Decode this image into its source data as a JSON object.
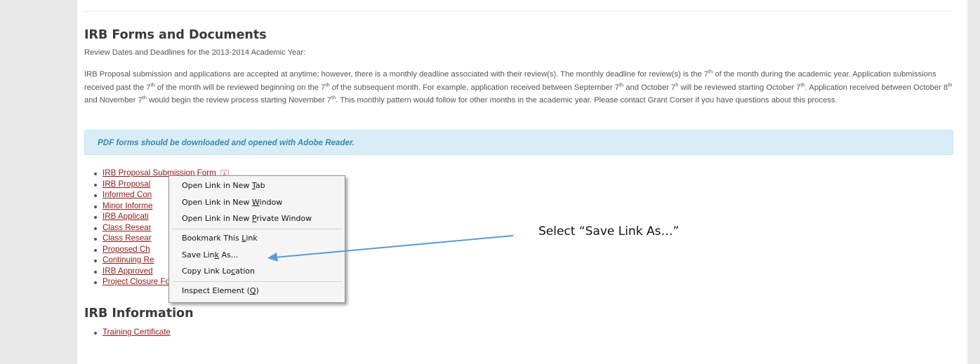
{
  "content": {
    "heading": "IRB Forms and Documents",
    "subtitle": "Review Dates and Deadlines for the 2013-2014 Academic Year:",
    "paragraph": {
      "p1": "IRB Proposal submission and applications are accepted at anytime; however, there is a monthly deadline associated with their review(s). The monthly deadline for review(s) is the 7",
      "p2": " of the month during the academic year. Application submissions received past the 7",
      "p3": " of the month will be reviewed beginning on the 7",
      "p4": " of the subsequent month. For example, application received between September 7",
      "p5": " and October 7",
      "p6": " will be reviewed starting October 7",
      "p7": ". Application received between October 8",
      "p8": " and November 7",
      "p9": " would begin the review process starting November 7",
      "p10": ". This monthly pattern would follow for other months in the academic year. Please contact Grant Corser if you have questions about this process.",
      "sup_th": "th",
      "sup_h": "h"
    },
    "notice": "PDF forms should be downloaded and opened with Adobe Reader.",
    "forms": [
      "IRB Proposal Submission Form",
      "IRB Proposal",
      "Informed Con",
      "Minor Informe",
      "IRB Applicati",
      "Class Resear",
      "Class Resear",
      "Proposed Ch",
      "Continuing Re",
      "IRB Approved",
      "Project Closure Form"
    ],
    "info_heading": "IRB Information",
    "info_links": [
      "Training Certificate"
    ]
  },
  "context_menu": {
    "items": [
      {
        "pre": "Open Link in New ",
        "key": "T",
        "post": "ab"
      },
      {
        "pre": "Open Link in New ",
        "key": "W",
        "post": "indow"
      },
      {
        "pre": "Open Link in New ",
        "key": "P",
        "post": "rivate Window"
      },
      {
        "pre": "Bookmark This ",
        "key": "L",
        "post": "ink"
      },
      {
        "pre": "Save Lin",
        "key": "k",
        "post": " As..."
      },
      {
        "pre": "Copy Link Lo",
        "key": "c",
        "post": "ation"
      },
      {
        "pre": "Inspect Element (",
        "key": "Q",
        "post": ")"
      }
    ]
  },
  "annotation": {
    "text": "Select “Save Link As…”",
    "arrow_color": "#5b9bd5"
  },
  "colors": {
    "link": "#8b1a1a",
    "notice_bg": "#d9edf7",
    "notice_text": "#3a87ad",
    "page_bg": "#e9e9e9"
  },
  "icons": {
    "pdf": "pdf-file-icon"
  }
}
